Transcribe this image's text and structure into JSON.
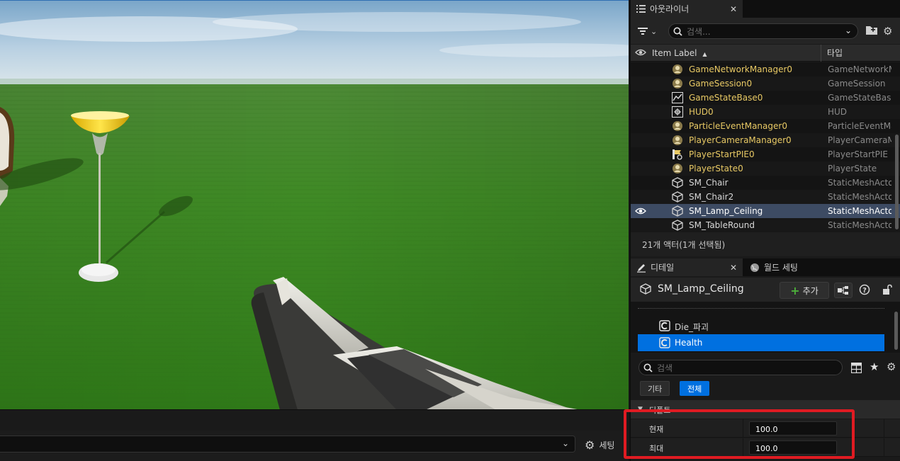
{
  "outliner": {
    "tab_title": "아웃라이너",
    "search_placeholder": "검색...",
    "col_label": "Item Label",
    "col_label_sort": "▲",
    "col_type": "타입",
    "rows": [
      {
        "label": "GameNetworkManager0",
        "type": "GameNetworkManager",
        "icon": "actor-icon"
      },
      {
        "label": "GameSession0",
        "type": "GameSession",
        "icon": "actor-icon"
      },
      {
        "label": "GameStateBase0",
        "type": "GameStateBase",
        "icon": "graph-icon"
      },
      {
        "label": "HUD0",
        "type": "HUD",
        "icon": "hud-icon"
      },
      {
        "label": "ParticleEventManager0",
        "type": "ParticleEventManager",
        "icon": "actor-icon"
      },
      {
        "label": "PlayerCameraManager0",
        "type": "PlayerCameraManager",
        "icon": "actor-icon"
      },
      {
        "label": "PlayerStartPIE0",
        "type": "PlayerStartPIE",
        "icon": "player-start-icon"
      },
      {
        "label": "PlayerState0",
        "type": "PlayerState",
        "icon": "actor-icon"
      },
      {
        "label": "SM_Chair",
        "type": "StaticMeshActor",
        "icon": "static-mesh-icon"
      },
      {
        "label": "SM_Chair2",
        "type": "StaticMeshActor",
        "icon": "static-mesh-icon"
      },
      {
        "label": "SM_Lamp_Ceiling",
        "type": "StaticMeshActor",
        "icon": "static-mesh-icon",
        "selected": true
      },
      {
        "label": "SM_TableRound",
        "type": "StaticMeshActor",
        "icon": "static-mesh-icon"
      }
    ],
    "status": "21개 액터(1개 선택됨)"
  },
  "details": {
    "tab_title": "디테일",
    "world_settings_tab": "월드 세팅",
    "actor_name": "SM_Lamp_Ceiling",
    "add_label": "추가",
    "components": [
      {
        "label": "Die_파괴",
        "icon": "component-c-icon"
      },
      {
        "label": "Health",
        "icon": "component-c-icon",
        "selected": true
      }
    ],
    "search_placeholder": "검색",
    "filter_tabs": {
      "misc": "기타",
      "all": "전체"
    },
    "category": "디폴트",
    "properties": [
      {
        "name": "현재",
        "value": "100.0"
      },
      {
        "name": "최대",
        "value": "100.0"
      }
    ]
  },
  "bottom": {
    "settings_label": "세팅"
  },
  "colors": {
    "accent": "#0070e0",
    "selection_row": "#3d4b63",
    "actor_label": "#e8c964",
    "highlight": "#e01b22",
    "add_plus": "#4caf3a"
  }
}
